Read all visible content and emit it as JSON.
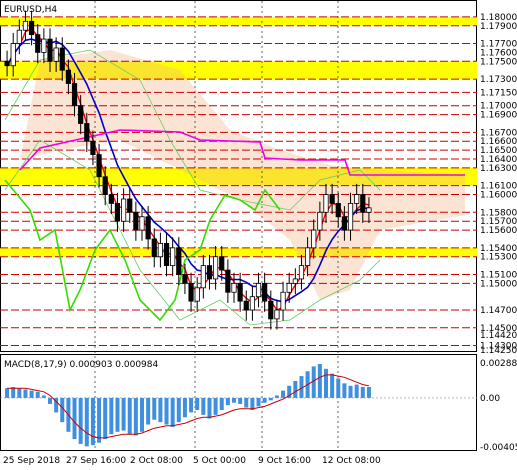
{
  "symbol_title": "EURUSD,H4",
  "macd_title": "MACD(8,17,9) 0.000903 0.000984",
  "price_axis_labels": [
    "1.18000",
    "1.17900",
    "1.17700",
    "1.17600",
    "1.17500",
    "1.17300",
    "1.17150",
    "1.17000",
    "1.16900",
    "1.16700",
    "1.16600",
    "1.16500",
    "1.16400",
    "1.16300",
    "1.16100",
    "1.16000",
    "1.15800",
    "1.15700",
    "1.15600",
    "1.15400",
    "1.15300",
    "1.15100",
    "1.15000",
    "1.14700",
    "1.14500",
    "1.14420",
    "1.14300",
    "1.14250"
  ],
  "macd_axis_labels": [
    "0.002882",
    "0.00",
    "-0.004055"
  ],
  "time_axis_labels": [
    "25 Sep 2018",
    "27 Sep 16:00",
    "2 Oct 08:00",
    "5 Oct 00:00",
    "9 Oct 16:00",
    "12 Oct 08:00"
  ],
  "colors": {
    "bull_bear_candle": "#000000",
    "support_zone": "#ffff00",
    "level_line": "#cc0000",
    "ma_red": "#ff0000",
    "ma_blue": "#0000cc",
    "ma_magenta": "#ee00ee",
    "ma_green": "#33dd00",
    "bollinger": "#66cc66",
    "ichimoku_cloud": "#f4b183",
    "macd_hist": "#3f8fe0",
    "macd_signal": "#cc0000"
  },
  "chart_data": {
    "type": "candlestick",
    "symbol": "EURUSD",
    "timeframe": "H4",
    "ylim": [
      1.1425,
      1.181
    ],
    "horizontal_levels": [
      1.18,
      1.179,
      1.177,
      1.175,
      1.173,
      1.1715,
      1.17,
      1.169,
      1.167,
      1.166,
      1.165,
      1.164,
      1.163,
      1.161,
      1.16,
      1.158,
      1.157,
      1.156,
      1.154,
      1.153,
      1.151,
      1.15,
      1.147,
      1.145,
      1.143
    ],
    "highlighted_zones": [
      [
        1.179,
        1.18
      ],
      [
        1.173,
        1.175
      ],
      [
        1.161,
        1.163
      ],
      [
        1.153,
        1.154
      ]
    ],
    "close_prices": [
      1.1745,
      1.177,
      1.1785,
      1.1795,
      1.178,
      1.176,
      1.1775,
      1.175,
      1.1765,
      1.174,
      1.1725,
      1.17,
      1.168,
      1.166,
      1.1645,
      1.162,
      1.16,
      1.159,
      1.157,
      1.1595,
      1.158,
      1.156,
      1.1575,
      1.155,
      1.153,
      1.1545,
      1.152,
      1.154,
      1.151,
      1.15,
      1.148,
      1.1495,
      1.152,
      1.1505,
      1.153,
      1.1515,
      1.149,
      1.15,
      1.148,
      1.147,
      1.1485,
      1.15,
      1.148,
      1.146,
      1.147,
      1.149,
      1.15,
      1.1505,
      1.152,
      1.154,
      1.156,
      1.158,
      1.16,
      1.159,
      1.1575,
      1.156,
      1.159,
      1.16,
      1.158,
      1.1585
    ],
    "macd": {
      "label": "MACD(8,17,9)",
      "main": 0.000903,
      "signal": 0.000984,
      "ylim": [
        -0.004055,
        0.002882
      ],
      "histogram": [
        0.0008,
        0.0009,
        0.0008,
        0.0007,
        0.0006,
        0.0005,
        0.0002,
        -0.0005,
        -0.0012,
        -0.002,
        -0.0028,
        -0.0034,
        -0.0038,
        -0.004,
        -0.0039,
        -0.0037,
        -0.0034,
        -0.003,
        -0.0028,
        -0.0027,
        -0.003,
        -0.0031,
        -0.0028,
        -0.0022,
        -0.0018,
        -0.002,
        -0.0022,
        -0.0024,
        -0.002,
        -0.0016,
        -0.0012,
        -0.001,
        -0.0014,
        -0.0017,
        -0.0014,
        -0.001,
        -0.0006,
        -0.0004,
        -0.0005,
        -0.0008,
        -0.001,
        -0.0007,
        -0.0004,
        -0.0002,
        0.0002,
        0.0006,
        0.001,
        0.0014,
        0.0018,
        0.0022,
        0.0026,
        0.0028,
        0.0024,
        0.002,
        0.0016,
        0.0012,
        0.001,
        0.0011,
        0.0009,
        0.0009
      ],
      "signal_line": [
        0.0008,
        0.0008,
        0.0008,
        0.0008,
        0.0007,
        0.0006,
        0.0005,
        0.0002,
        -0.0003,
        -0.0008,
        -0.0014,
        -0.002,
        -0.0025,
        -0.0029,
        -0.0032,
        -0.0033,
        -0.0033,
        -0.0032,
        -0.0031,
        -0.003,
        -0.003,
        -0.003,
        -0.0029,
        -0.0027,
        -0.0025,
        -0.0024,
        -0.0023,
        -0.0023,
        -0.0022,
        -0.0021,
        -0.0019,
        -0.0017,
        -0.0016,
        -0.0016,
        -0.0015,
        -0.0014,
        -0.0012,
        -0.001,
        -0.0009,
        -0.0009,
        -0.0009,
        -0.0008,
        -0.0007,
        -0.0005,
        -0.0003,
        -0.0001,
        0.0002,
        0.0005,
        0.0008,
        0.0011,
        0.0014,
        0.0017,
        0.0019,
        0.0019,
        0.0018,
        0.0017,
        0.0015,
        0.0013,
        0.0011,
        0.001
      ]
    }
  }
}
